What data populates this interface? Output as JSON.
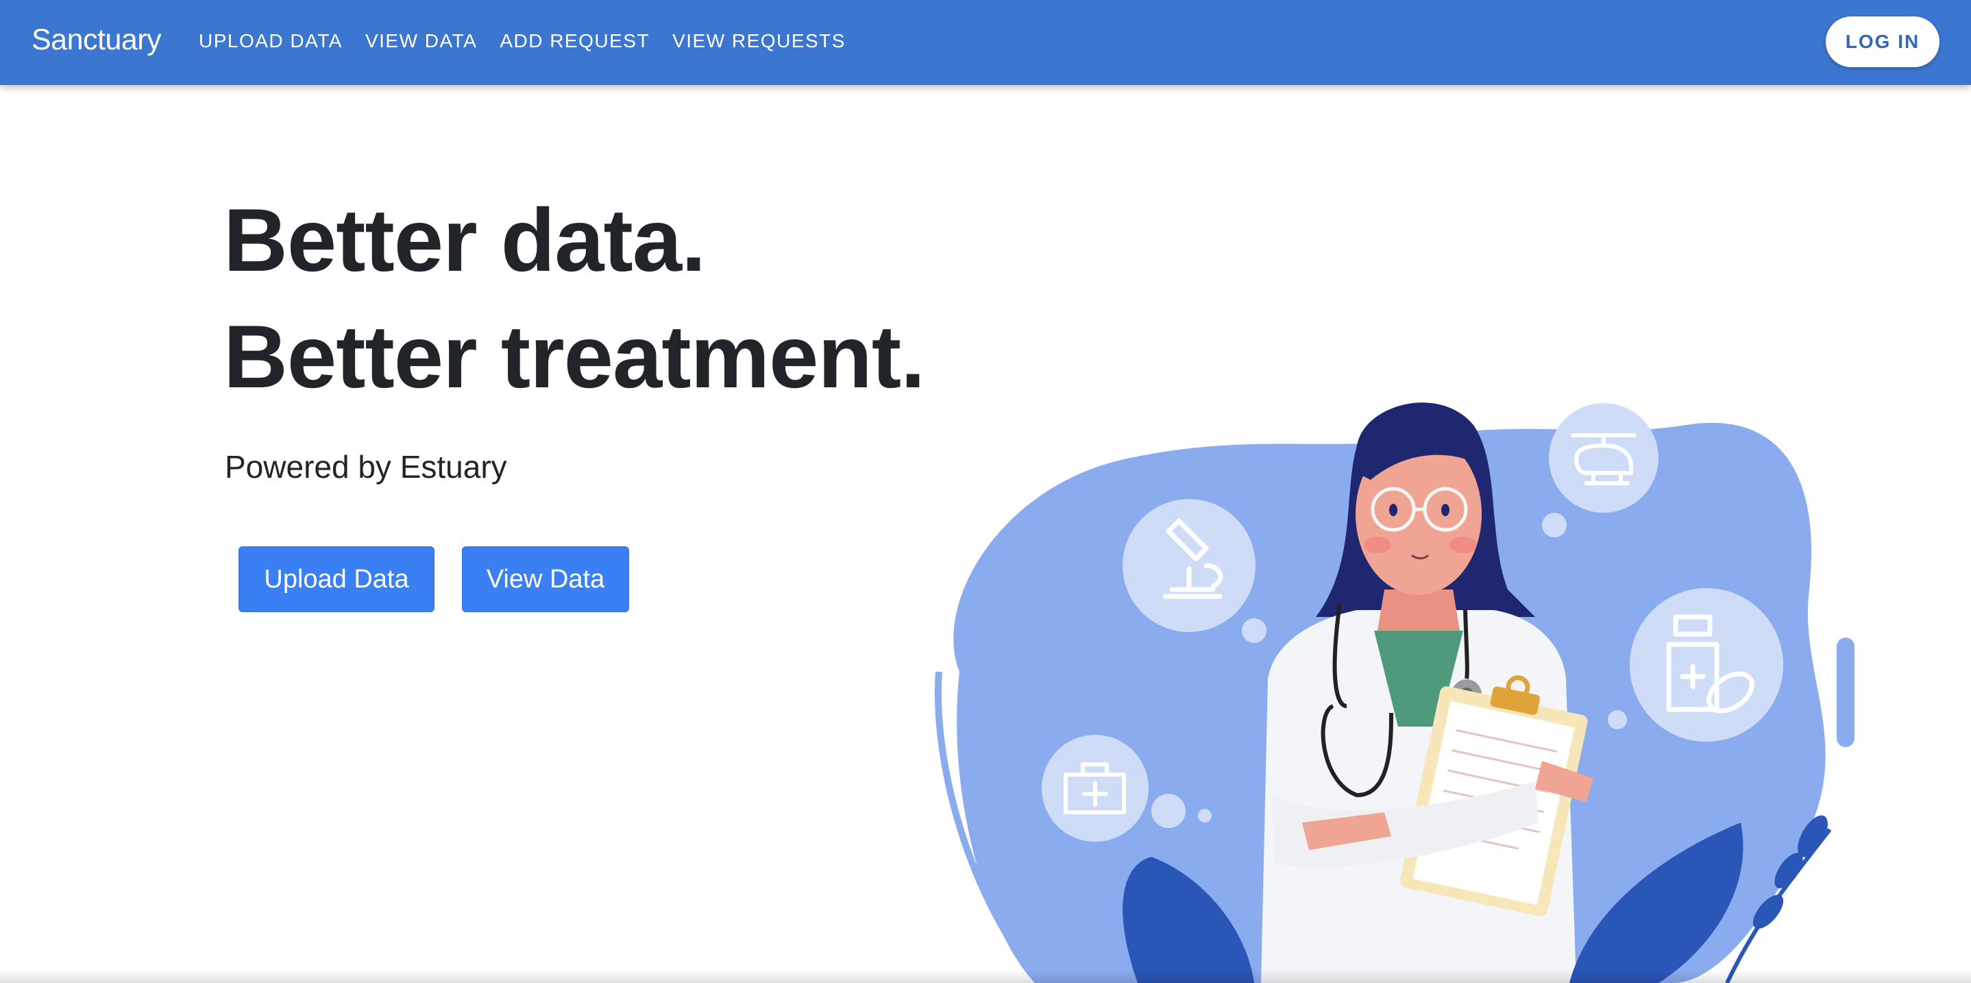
{
  "navbar": {
    "brand": "Sanctuary",
    "links": [
      "UPLOAD DATA",
      "VIEW DATA",
      "ADD REQUEST",
      "VIEW REQUESTS"
    ],
    "login_label": "LOG IN",
    "background_color": "#3b76d0"
  },
  "hero": {
    "headline_line1": "Better data.",
    "headline_line2": "Better treatment.",
    "subtitle": "Powered by Estuary",
    "buttons": {
      "upload_label": "Upload Data",
      "view_label": "View Data"
    },
    "button_color": "#3b7ff5"
  },
  "illustration": {
    "subject": "doctor-with-clipboard",
    "icons": [
      "microscope-icon",
      "helicopter-icon",
      "medicine-bottle-icon",
      "first-aid-kit-icon"
    ],
    "blob_color": "#8aacee",
    "leaf_color": "#2a56b8"
  }
}
